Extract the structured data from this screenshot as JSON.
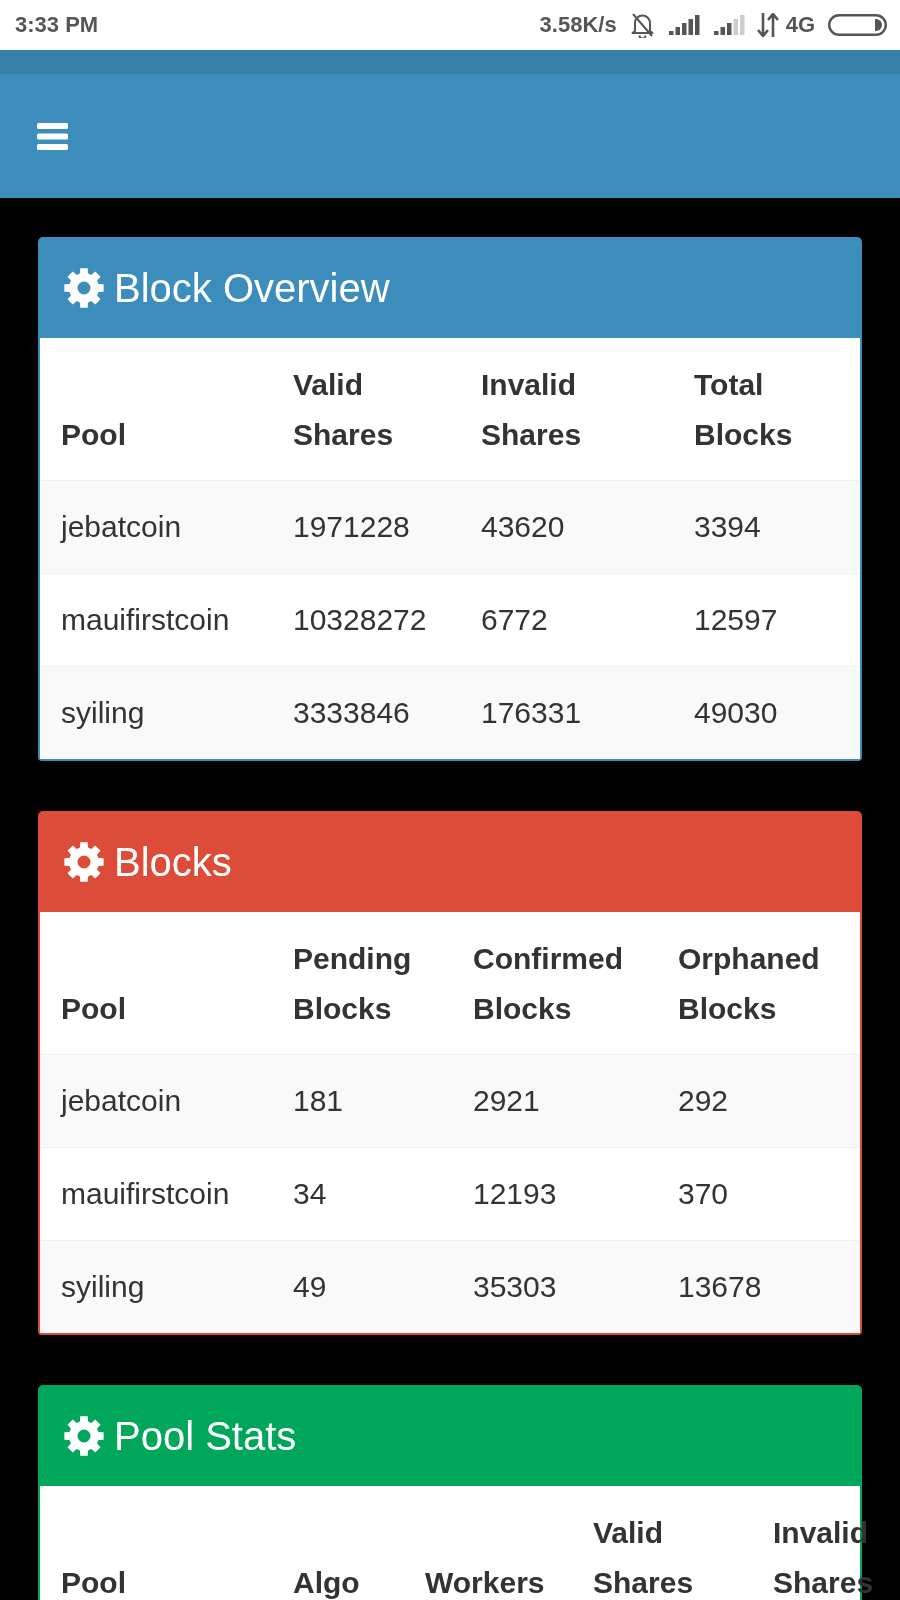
{
  "status_bar": {
    "time": "3:33 PM",
    "network_speed": "3.58K/s",
    "network_type": "4G"
  },
  "panels": [
    {
      "title": "Block Overview",
      "color": "#3c8dbc",
      "columns": [
        "Pool",
        "Valid Shares",
        "Invalid Shares",
        "Total Blocks"
      ],
      "rows": [
        [
          "jebatcoin",
          "1971228",
          "43620",
          "3394"
        ],
        [
          "mauifirstcoin",
          "10328272",
          "6772",
          "12597"
        ],
        [
          "syiling",
          "3333846",
          "176331",
          "49030"
        ]
      ]
    },
    {
      "title": "Blocks",
      "color": "#dd4b39",
      "columns": [
        "Pool",
        "Pending Blocks",
        "Confirmed Blocks",
        "Orphaned Blocks"
      ],
      "rows": [
        [
          "jebatcoin",
          "181",
          "2921",
          "292"
        ],
        [
          "mauifirstcoin",
          "34",
          "12193",
          "370"
        ],
        [
          "syiling",
          "49",
          "35303",
          "13678"
        ]
      ]
    },
    {
      "title": "Pool Stats",
      "color": "#00a65a",
      "columns": [
        "Pool",
        "Algo",
        "Workers",
        "Valid Shares",
        "Invalid Shares"
      ]
    }
  ]
}
